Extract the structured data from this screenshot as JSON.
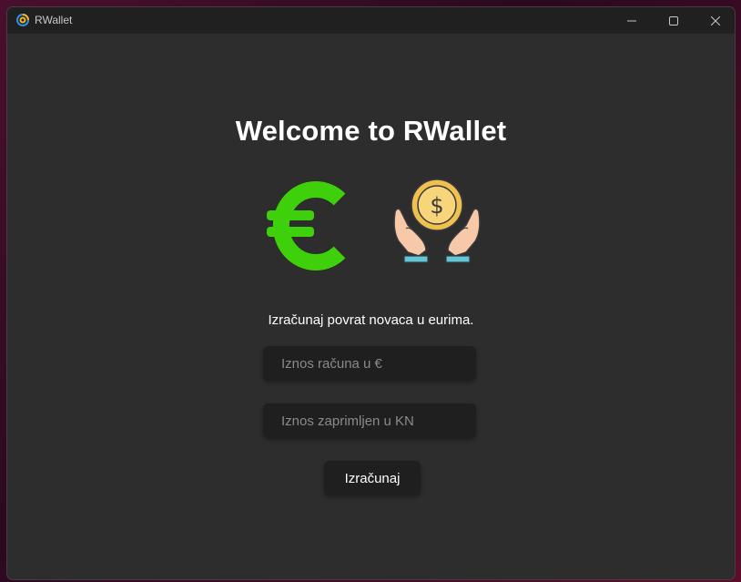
{
  "window": {
    "title": "RWallet"
  },
  "main": {
    "heading": "Welcome to RWallet",
    "subtitle": "Izračunaj povrat novaca u eurima.",
    "amount_field": {
      "placeholder": "Iznos računa u €",
      "value": ""
    },
    "received_field": {
      "placeholder": "Iznos zaprimljen u KN",
      "value": ""
    },
    "calculate_button": "Izračunaj"
  },
  "icons": {
    "app": "rwallet-logo-icon",
    "euro": "euro-icon",
    "money": "hands-coin-icon"
  },
  "colors": {
    "window_bg": "#2d2d2d",
    "titlebar_bg": "#202020",
    "euro_green": "#3ed00b",
    "coin_gold": "#f7d57a",
    "input_bg": "#1f1f1f"
  }
}
